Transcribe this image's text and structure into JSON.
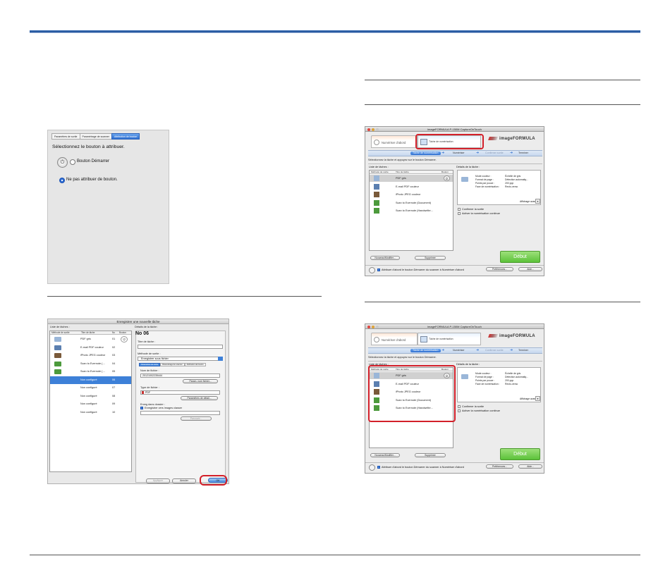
{
  "rules": {
    "accent": "#1f4f95",
    "highlight": "#d3202a"
  },
  "panel1": {
    "tabs": [
      "Paramètres de sortie",
      "Paramétrage de scanner",
      "Attribution de bouton"
    ],
    "active_tab": 2,
    "prompt": "Sélectionnez le bouton à attribuer.",
    "option_start": "Bouton Démarrer",
    "option_none": "Ne pas attribuer de bouton."
  },
  "panel2": {
    "title": "Enregistrer une nouvelle tâche",
    "list_title": "Liste de tâches :",
    "details_title": "Détails de la tâche :",
    "columns": [
      "Méthode de sortie",
      "Titre de tâche",
      "No",
      "Bouton"
    ],
    "rows": [
      {
        "title": "PDF gris",
        "no": "01",
        "kind": "folder"
      },
      {
        "title": "E-mail PDF couleur",
        "no": "02",
        "kind": "mail"
      },
      {
        "title": "iPhoto JPEG couleur",
        "no": "03",
        "kind": "photo"
      },
      {
        "title": "Scan to Evernote (…",
        "no": "04",
        "kind": "evernote"
      },
      {
        "title": "Scan to Evernote (…",
        "no": "05",
        "kind": "evernote"
      },
      {
        "title": "Non configuré",
        "no": "06",
        "kind": "none"
      },
      {
        "title": "Non configuré",
        "no": "07",
        "kind": "none"
      },
      {
        "title": "Non configuré",
        "no": "08",
        "kind": "none"
      },
      {
        "title": "Non configuré",
        "no": "09",
        "kind": "none"
      },
      {
        "title": "Non configuré",
        "no": "10",
        "kind": "none"
      }
    ],
    "selected_row": 5,
    "no_heading": "No 06",
    "task_title_label": "Titre de tâche :",
    "output_label": "Méthode de sortie :",
    "output_value": "Enregistrer sous fichier",
    "subtabs": [
      "Paramètres de sortie",
      "Paramétrage de scanner",
      "Attribution de bouton"
    ],
    "filename_label": "Nom de fichier :",
    "filename_value": "20121002235444",
    "filename_button": "Param. nom fichier...",
    "filetype_label": "Type de fichier :",
    "filetype_value": "PDF",
    "detail_button": "Paramètres de détail...",
    "folder_label": "Enreg dans dossier :",
    "folder_check": "Enregistrer vers images classer",
    "browse_button": "Parcourir...",
    "apply_button": "Appliquer",
    "cancel_button": "Annuler",
    "ok_button": "OK"
  },
  "window": {
    "title": "imageFORMULA P-150M CaptureOnTouch",
    "logo": "imageFORMULA",
    "tab_scan_first": "Numériser d'abord",
    "tab_task_scan": "Tâche de numérisation",
    "steps": [
      "Tâche de numérisation",
      "Numériser",
      "Confirmer sortie",
      "Terminer"
    ],
    "instruction": "Sélectionnez la tâche et appuyez sur le bouton Démarrer.",
    "list_title": "Liste de tâches :",
    "details_title": "Détails de la tâche :",
    "columns": [
      "Méthode de sortie",
      "Titre de tâche",
      "Bouton"
    ],
    "rows": [
      {
        "name": "PDF gris",
        "kind": "folder"
      },
      {
        "name": "E-mail PDF couleur",
        "kind": "mail"
      },
      {
        "name": "iPhoto JPEG couleur",
        "kind": "photo"
      },
      {
        "name": "Scan to Evernote (Document)",
        "kind": "evernote"
      },
      {
        "name": "Scan to Evernote (Handwritte…",
        "kind": "evernote"
      }
    ],
    "details": [
      {
        "key": "Mode couleur :",
        "value": "Échelle de gris"
      },
      {
        "key": "Format de page :",
        "value": "Détection automatiq..."
      },
      {
        "key": "Points par pouce :",
        "value": "200 ppp"
      },
      {
        "key": "Face de numérisation :",
        "value": "Recto-verso"
      }
    ],
    "advanced": "Affichage avancé",
    "confirm_output": "Confirmer la sortie",
    "continuous": "Activer la numérisation continue",
    "edit_button": "Nouveau/Modifier...",
    "delete_button": "Supprimer",
    "start_button": "Début",
    "footer_check": "Attribuer d'abord le bouton Démarrer du scanner à Numériser d'abord",
    "prefs_button": "Préférences...",
    "help_button": "Aide..."
  }
}
